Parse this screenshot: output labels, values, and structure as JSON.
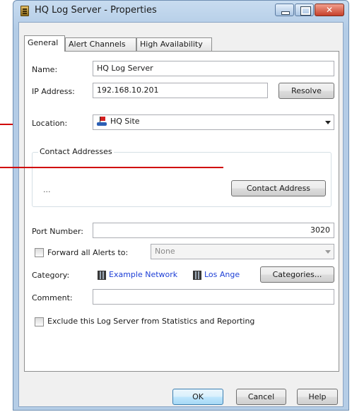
{
  "window": {
    "title": "HQ Log Server - Properties"
  },
  "tabs": [
    "General",
    "Alert Channels",
    "High Availability"
  ],
  "form": {
    "name_label": "Name:",
    "name_value": "HQ Log Server",
    "ip_label": "IP Address:",
    "ip_value": "192.168.10.201",
    "resolve_label": "Resolve",
    "location_label": "Location:",
    "location_value": "HQ Site",
    "contact_group_title": "Contact Addresses",
    "contact_placeholder": "...",
    "contact_button": "Contact Address",
    "port_label": "Port Number:",
    "port_value": "3020",
    "forward_label": "Forward all Alerts to:",
    "forward_value": "None",
    "category_label": "Category:",
    "categories": [
      "Example Network",
      "Los Ange"
    ],
    "categories_button": "Categories...",
    "comment_label": "Comment:",
    "comment_value": "",
    "exclude_label": "Exclude this Log Server from Statistics and Reporting"
  },
  "buttons": {
    "ok": "OK",
    "cancel": "Cancel",
    "help": "Help"
  },
  "colors": {
    "callout_line": "#d00000",
    "category_link": "#1d3fd6"
  }
}
